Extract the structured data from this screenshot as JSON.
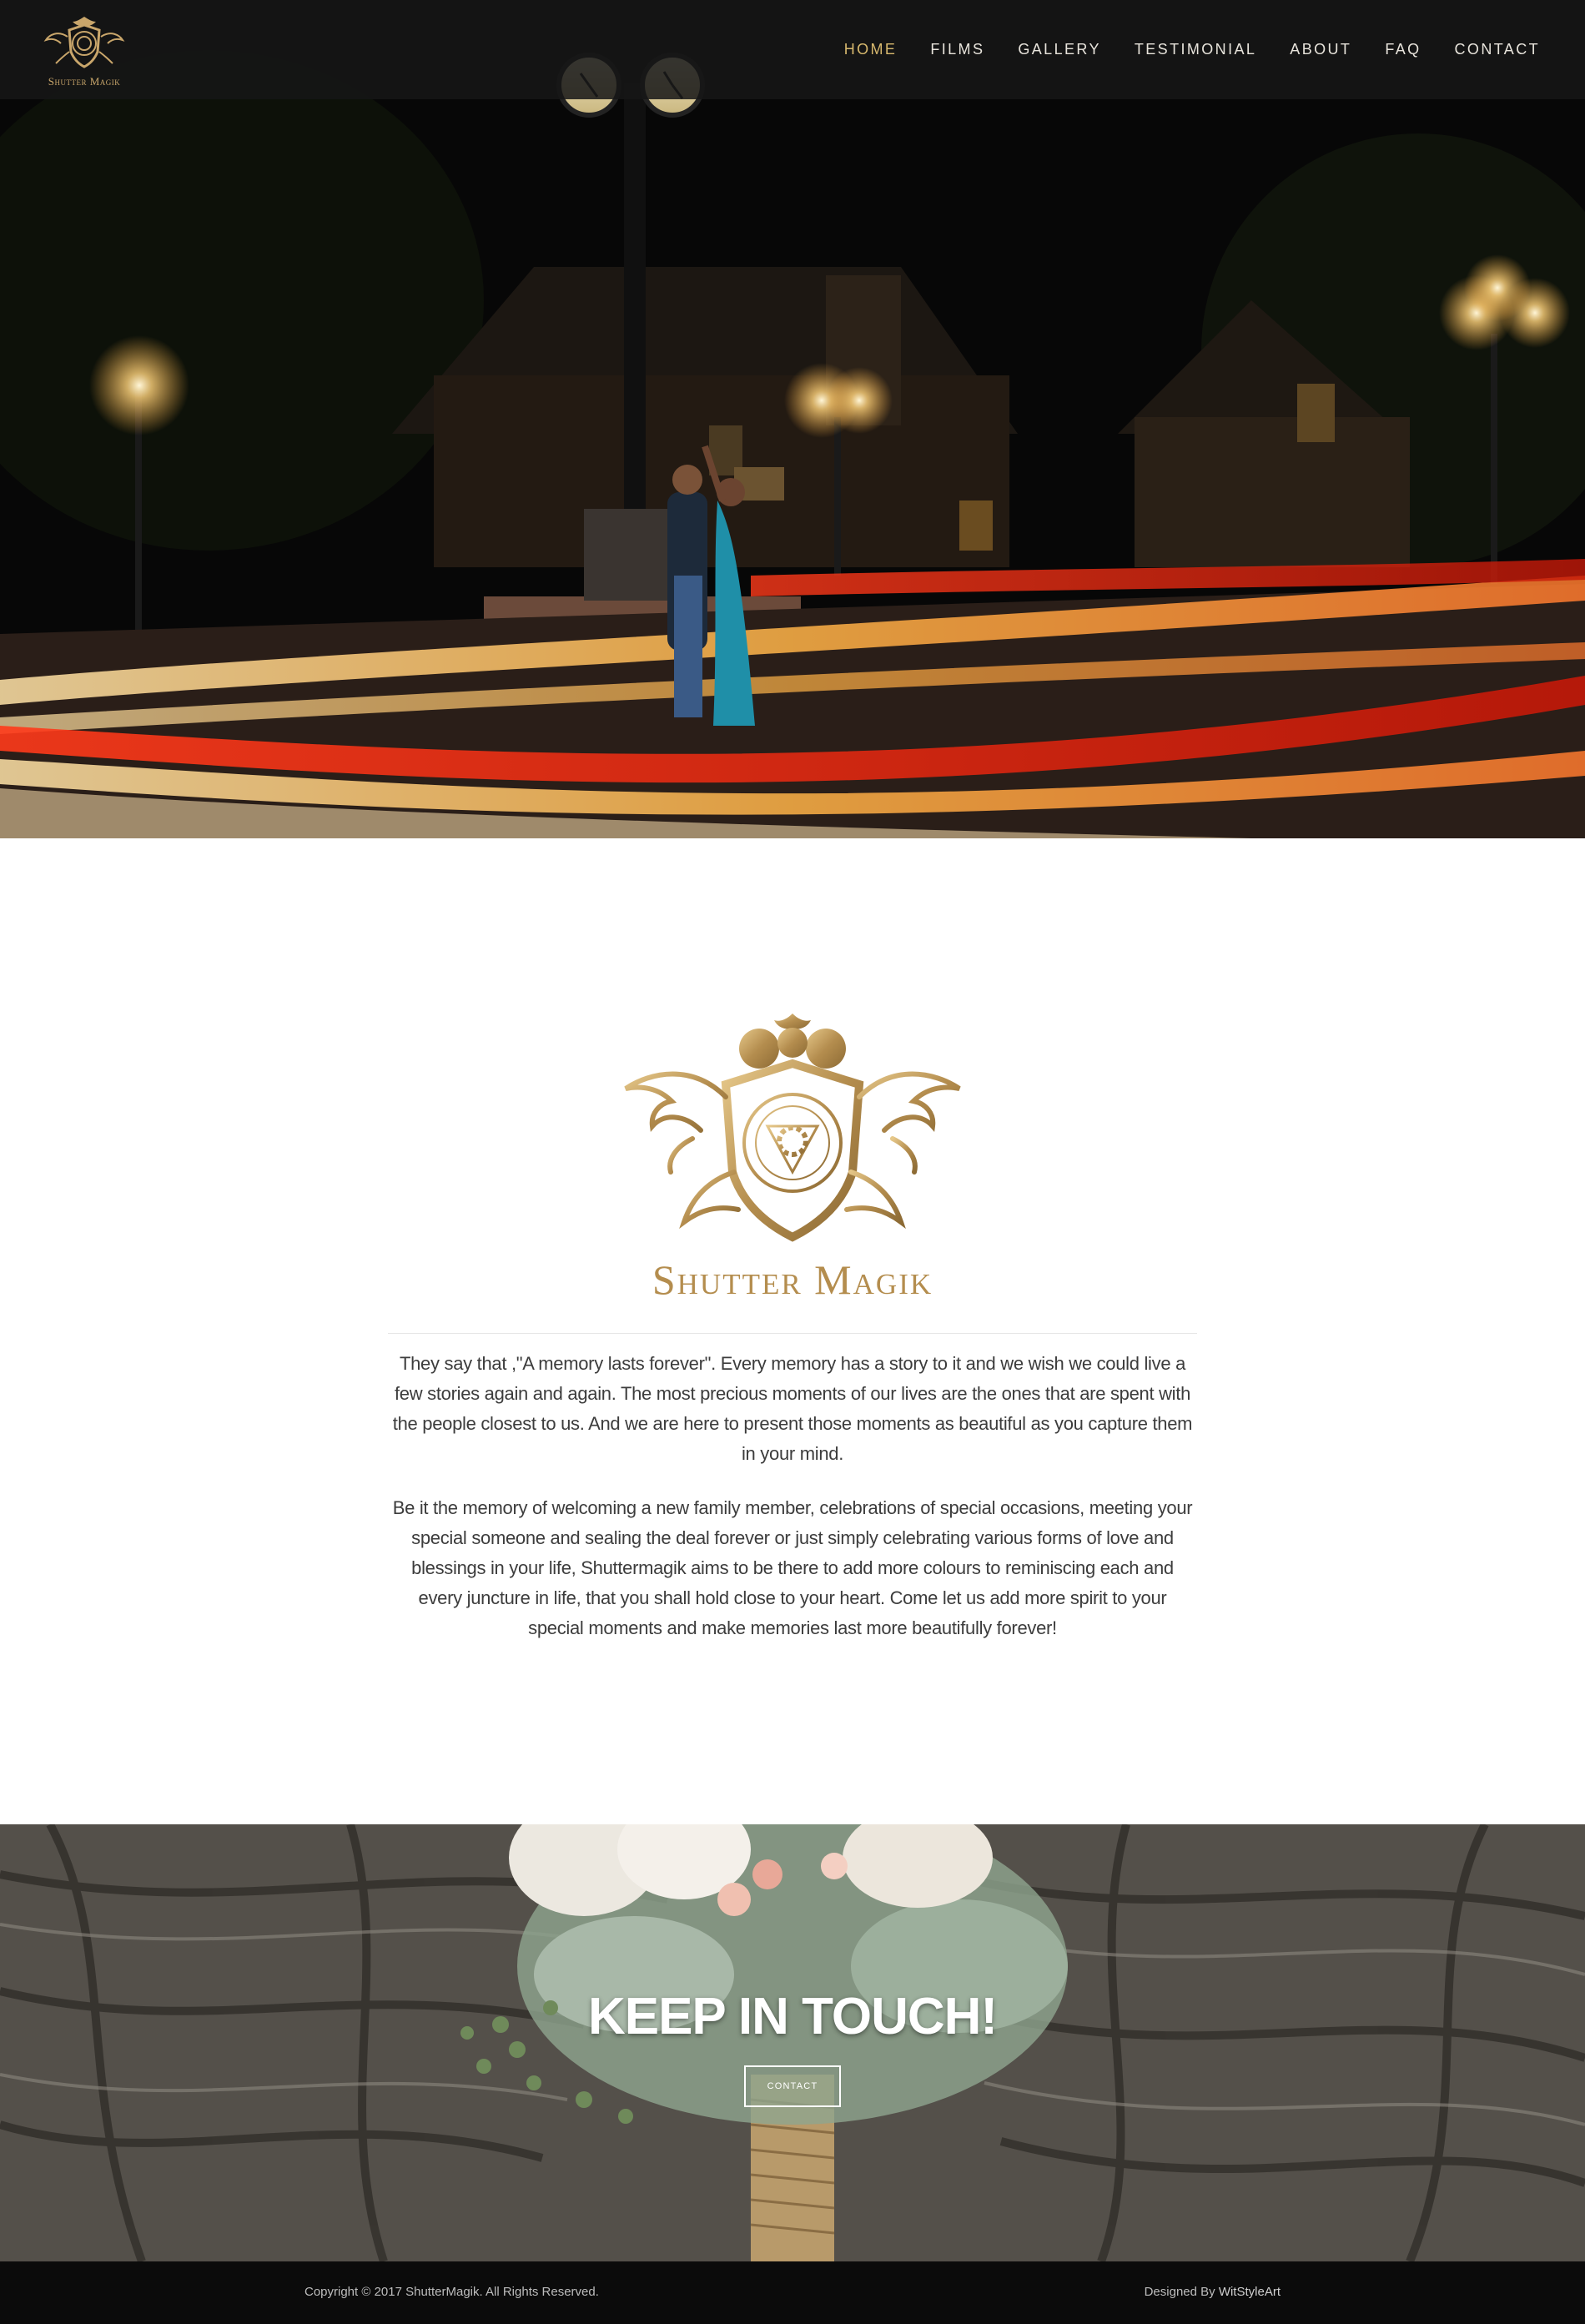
{
  "header": {
    "logo_text": "Shutter Magik",
    "nav": [
      {
        "label": "HOME",
        "active": true
      },
      {
        "label": "FILMS",
        "active": false
      },
      {
        "label": "GALLERY",
        "active": false
      },
      {
        "label": "TESTIMONIAL",
        "active": false
      },
      {
        "label": "ABOUT",
        "active": false
      },
      {
        "label": "FAQ",
        "active": false
      },
      {
        "label": "CONTACT",
        "active": false
      }
    ]
  },
  "about": {
    "logo_text": "Shutter Magik",
    "paragraphs": [
      "They say that ,\"A memory lasts forever\". Every memory has a story to it and we wish we could live a few stories again and again. The most precious moments of our lives are the ones that are spent with the people closest to us. And we are here to present those moments as beautiful as you capture them in your mind.",
      "Be it the memory of welcoming a new family member, celebrations of special occasions, meeting your special someone and sealing the deal forever or just simply celebrating various forms of love and blessings in your life, Shuttermagik aims to be there to add more colours to reminiscing each and every juncture in life, that you shall hold close to your heart. Come let us add more spirit to your special moments and make memories last more beautifully forever!"
    ]
  },
  "touch": {
    "title": "KEEP IN TOUCH!",
    "button_label": "CONTACT"
  },
  "footer": {
    "copyright": "Copyright © 2017 ShutterMagik. All Rights Reserved.",
    "designed_prefix": "Designed By ",
    "designed_link": "WitStyleArt"
  },
  "colors": {
    "accent_gold": "#d8b96e",
    "logo_gold": "#b48d4e",
    "topbar_bg": "#161616",
    "footer_bg": "#0b0b0b"
  }
}
